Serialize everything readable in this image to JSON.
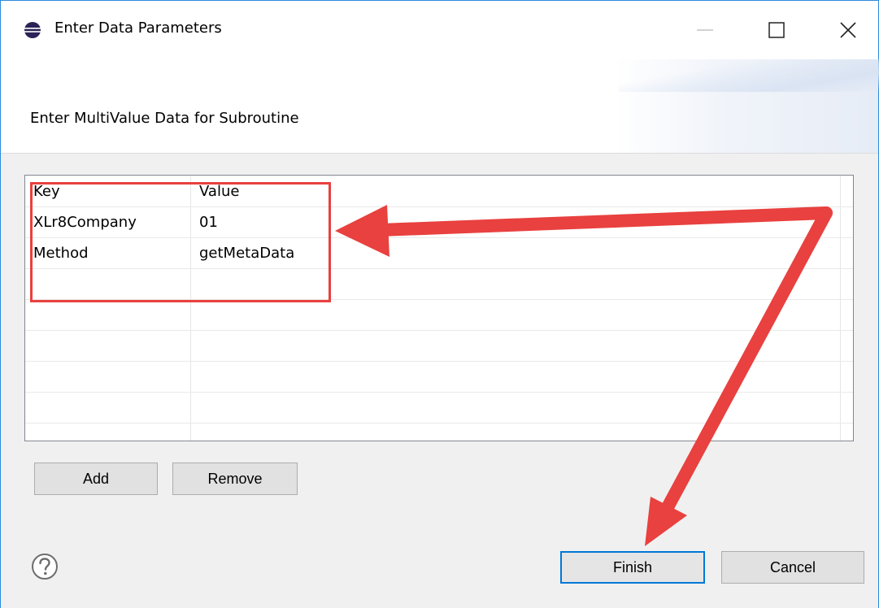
{
  "window": {
    "title": "Enter Data Parameters",
    "controls": {
      "minimize": "minimize",
      "maximize": "maximize",
      "close": "close"
    }
  },
  "banner": {
    "message": "Enter MultiValue Data for Subroutine"
  },
  "table": {
    "columns": [
      "Key",
      "Value"
    ],
    "rows": [
      {
        "key": "XLr8Company",
        "value": "01"
      },
      {
        "key": "Method",
        "value": "getMetaData"
      }
    ],
    "empty_rows": 5
  },
  "buttons": {
    "add": "Add",
    "remove": "Remove",
    "finish": "Finish",
    "cancel": "Cancel"
  },
  "icons": {
    "app": "eclipse-icon",
    "help": "help-icon"
  },
  "colors": {
    "annotation": "#e8413f",
    "focus": "#0078d7",
    "window_border": "#2b8be0"
  }
}
